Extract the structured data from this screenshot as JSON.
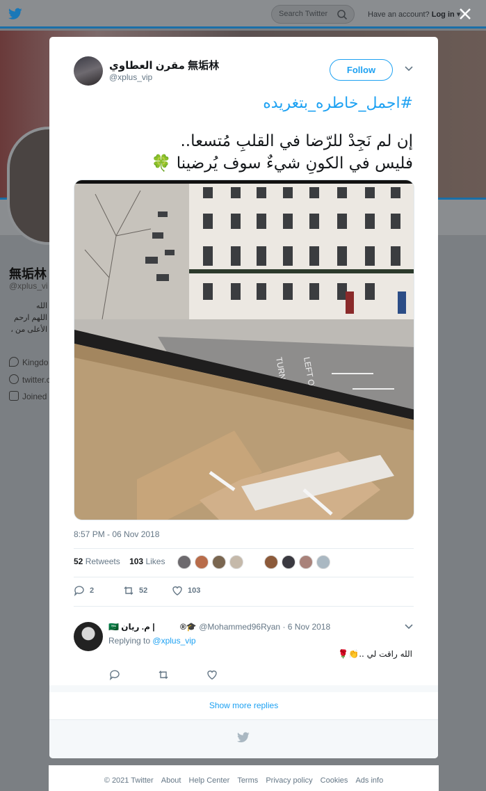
{
  "nav": {
    "search_placeholder": "Search Twitter",
    "account_prompt": "Have an account?",
    "login_label": "Log in"
  },
  "background_profile": {
    "name": "無垢林",
    "handle": "@xplus_vi",
    "bio_lines": [
      "الله",
      "اللهم ارحم",
      "، الأعلى من"
    ],
    "location": "Kingdo",
    "website": "twitter.c",
    "joined": "Joined"
  },
  "tweet": {
    "author_name": "مقرن العطاوي 無垢林",
    "author_handle": "@xplus_vip",
    "follow_label": "Follow",
    "hashtag": "#اجمل_خاطره_بتغريده",
    "lines": [
      "إن لم نَجِدْ للرّضا في القلبِ مُتسعا..",
      "فليس في الكونِ شيءٌ سوف يُرضينا 🍀"
    ],
    "timestamp": "8:57 PM - 06 Nov 2018",
    "retweets_count": "52",
    "retweets_label": "Retweets",
    "likes_count": "103",
    "likes_label": "Likes",
    "reply_count": "2",
    "retweet_action_count": "52",
    "like_action_count": "103"
  },
  "photo": {
    "road_text_1": "TURN AHEAD",
    "road_text_2": "LEFT ONLY"
  },
  "reply": {
    "name": "🇸🇦 م. ريان | ᅠᅠᅠ®🎓",
    "handle": "@Mohammed96Ryan",
    "date": "· 6 Nov 2018",
    "replying_prefix": "Replying to",
    "replying_to": "@xplus_vip",
    "text": "الله راقت لي ..👏🌹"
  },
  "show_more_replies": "Show more replies",
  "footer": {
    "copyright": "© 2021 Twitter",
    "links": [
      "About",
      "Help Center",
      "Terms",
      "Privacy policy",
      "Cookies",
      "Ads info"
    ]
  },
  "colors": {
    "twitter_blue": "#1da1f2",
    "overlay": "#7b7f83",
    "secondary_text": "#657786"
  }
}
